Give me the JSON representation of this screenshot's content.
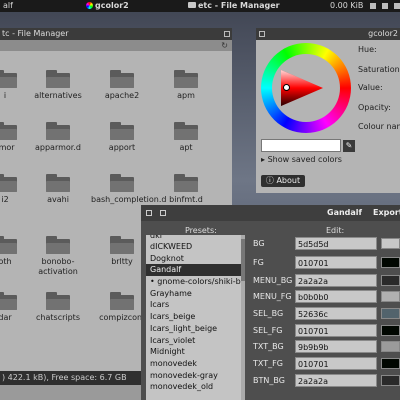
{
  "panel": {
    "app": "gcolor2",
    "window": "etc - File Manager",
    "net": "0.00 KiB"
  },
  "file_manager": {
    "title": "tc - File Manager",
    "items": [
      "i",
      "alternatives",
      "apache2",
      "apm",
      "rmor",
      "apparmor.d",
      "apport",
      "apt",
      "i2",
      "avahi",
      "bash_completion.d",
      "binfmt.d",
      "oth",
      "bonobo-activation",
      "brltty",
      "dar",
      "chatscripts",
      "compizconf"
    ],
    "status": ") 422.1 kB), Free space: 6.7 GB"
  },
  "gcolor": {
    "title": "gcolor2",
    "labels": {
      "hue": "Hue:",
      "saturation": "Saturation:",
      "value": "Value:",
      "opacity": "Opacity:",
      "colour_name": "Colour nam"
    },
    "show_saved": "Show saved colors",
    "about": "About",
    "swatch_color": "#ffffff"
  },
  "theme": {
    "name": "Gandalf",
    "export": "Export t",
    "presets_header": "Presets:",
    "edit_header": "Edit:",
    "presets": [
      "dkl",
      "dICKWEED",
      "Dogknot",
      "Gandalf",
      "gnome-colors/shiki-brave",
      "Grayhame",
      "Icars",
      "Icars_beige",
      "Icars_light_beige",
      "Icars_violet",
      "Midnight",
      "monovedek",
      "monovedek-gray",
      "monovedek_old"
    ],
    "selected_preset": "Gandalf",
    "fields": [
      {
        "key": "BG",
        "value": "5d5d5d",
        "swatch": "#c8c8c8"
      },
      {
        "key": "FG",
        "value": "010701",
        "swatch": "#010701"
      },
      {
        "key": "MENU_BG",
        "value": "2a2a2a",
        "swatch": "#2a2a2a"
      },
      {
        "key": "MENU_FG",
        "value": "b0b0b0",
        "swatch": "#b0b0b0"
      },
      {
        "key": "SEL_BG",
        "value": "52636c",
        "swatch": "#52636c"
      },
      {
        "key": "SEL_FG",
        "value": "010701",
        "swatch": "#010701"
      },
      {
        "key": "TXT_BG",
        "value": "9b9b9b",
        "swatch": "#9b9b9b"
      },
      {
        "key": "TXT_FG",
        "value": "010701",
        "swatch": "#010701"
      },
      {
        "key": "BTN_BG",
        "value": "2a2a2a",
        "swatch": "#2a2a2a"
      }
    ]
  }
}
